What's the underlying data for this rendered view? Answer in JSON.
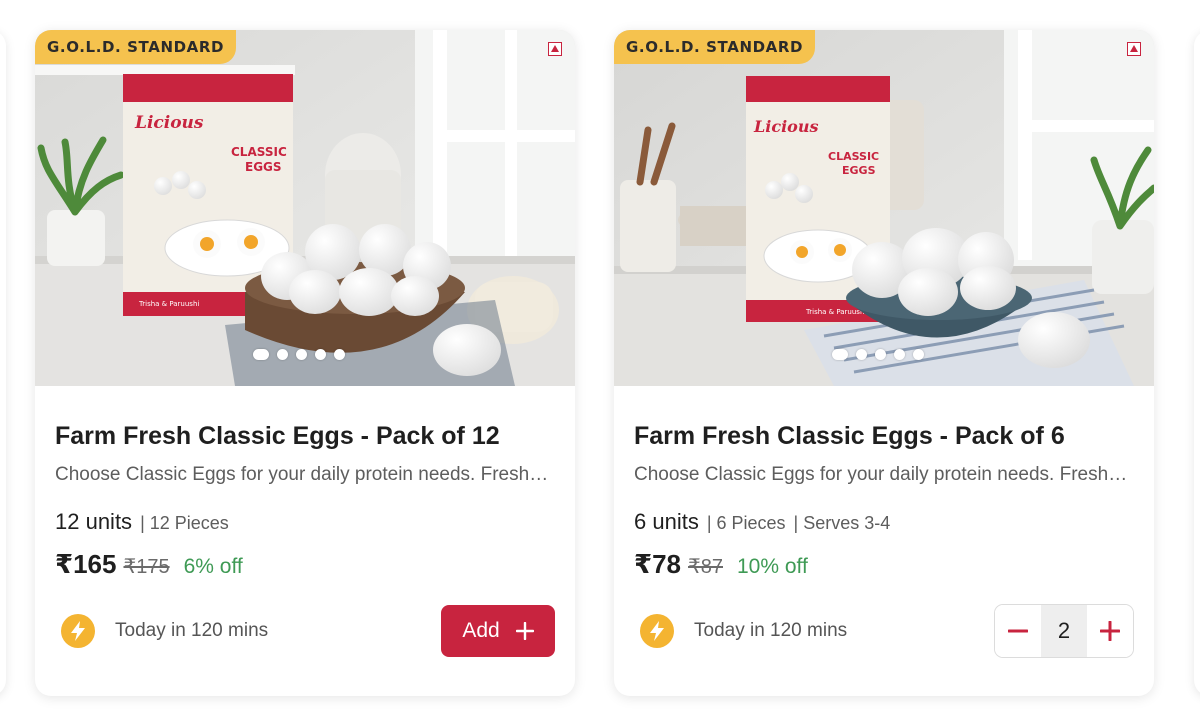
{
  "products": [
    {
      "badge": "G.O.L.D. STANDARD",
      "title": "Farm Fresh Classic Eggs - Pack of 12",
      "description": "Choose Classic Eggs for your daily protein needs. Fresh, t…",
      "units": "12 units",
      "pieces": "| 12 Pieces",
      "serves": "",
      "price": "₹165",
      "mrp": "₹175",
      "discount": "6% off",
      "delivery": "Today in 120 mins",
      "add_label": "Add",
      "carousel_count": 5,
      "carousel_active": 1,
      "box": {
        "brand": "Licious",
        "line1": "CLASSIC",
        "line2": "EGGS",
        "caption": "Trisha & Paruushi"
      }
    },
    {
      "badge": "G.O.L.D. STANDARD",
      "title": "Farm Fresh Classic Eggs - Pack of 6",
      "description": "Choose Classic Eggs for your daily protein needs. Fresh, t…",
      "units": "6 units",
      "pieces": "| 6 Pieces",
      "serves": "| Serves 3-4",
      "price": "₹78",
      "mrp": "₹87",
      "discount": "10% off",
      "delivery": "Today in 120 mins",
      "quantity": "2",
      "carousel_count": 5,
      "carousel_active": 1,
      "box": {
        "brand": "Licious",
        "line1": "CLASSIC",
        "line2": "EGGS",
        "caption": "Trisha & Paruushi"
      }
    }
  ],
  "colors": {
    "accent": "#c8243f",
    "badge": "#f5c24e",
    "discount": "#3f9a55",
    "bolt": "#f4b431"
  },
  "icons": {
    "ad": "ad-choices-icon",
    "bolt": "lightning-bolt-icon",
    "add": "plus-icon",
    "minus": "minus-icon"
  }
}
